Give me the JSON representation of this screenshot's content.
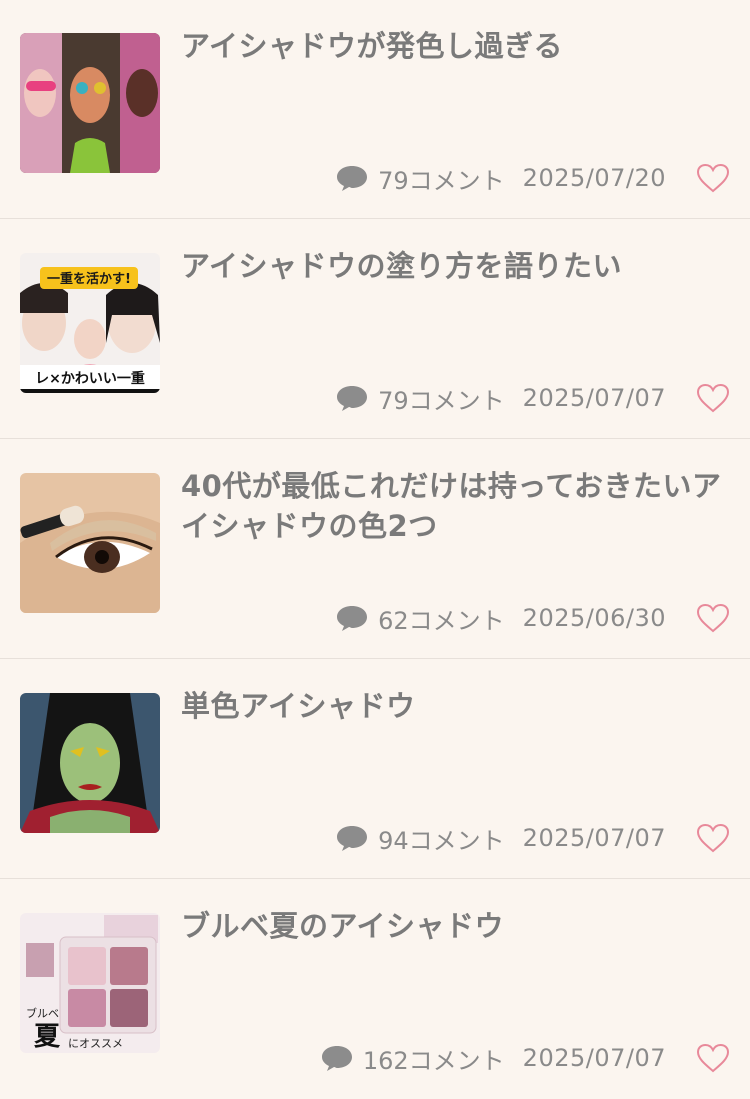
{
  "articles": [
    {
      "title": "アイシャドウが発色し過ぎる",
      "comments": "79コメント",
      "date": "2025/07/20",
      "thumb_icon": "makeup-models-photo"
    },
    {
      "title": "アイシャドウの塗り方を語りたい",
      "comments": "79コメント",
      "date": "2025/07/07",
      "thumb_icon": "youtube-thumbnail-photo",
      "thumb_text_top": "一重を活かす!",
      "thumb_text_bottom": "レ×かわいい一重"
    },
    {
      "title": "40代が最低これだけは持っておきたいアイシャドウの色2つ",
      "comments": "62コメント",
      "date": "2025/06/30",
      "thumb_icon": "eye-brush-photo"
    },
    {
      "title": "単色アイシャドウ",
      "comments": "94コメント",
      "date": "2025/07/07",
      "thumb_icon": "villain-illustration"
    },
    {
      "title": "ブルベ夏のアイシャドウ",
      "comments": "162コメント",
      "date": "2025/07/07",
      "thumb_icon": "palette-product-photo",
      "thumb_text_a": "ブルベ",
      "thumb_text_b": "夏",
      "thumb_text_c": "にオススメ"
    }
  ],
  "icons": {
    "comment": "speech-bubble-icon",
    "favorite": "heart-outline-icon"
  },
  "colors": {
    "background": "#fbf5ef",
    "heart": "#e8899a",
    "text": "#7a7a7a"
  }
}
